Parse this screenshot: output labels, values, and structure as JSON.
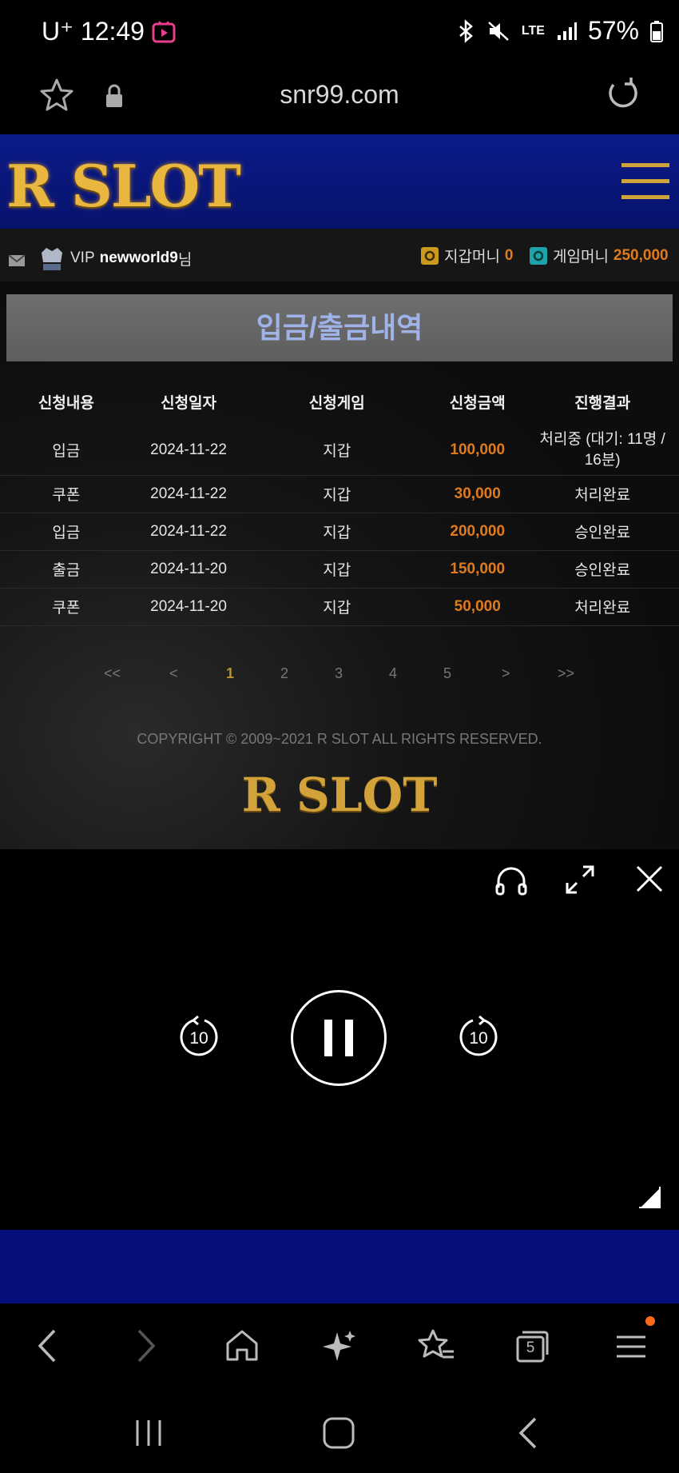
{
  "status_bar": {
    "carrier": "U⁺",
    "time": "12:49",
    "network": "LTE",
    "battery": "57%"
  },
  "browser": {
    "url": "snr99.com",
    "tab_count": "5"
  },
  "site": {
    "logo_text": "R SLOT",
    "user": {
      "level": "VIP",
      "username": "newworld9",
      "suffix": "님",
      "wallet_label": "지갑머니",
      "wallet_value": "0",
      "game_label": "게임머니",
      "game_value": "250,000"
    },
    "page_title": "입금/출금내역",
    "table": {
      "headers": [
        "신청내용",
        "신청일자",
        "신청게임",
        "신청금액",
        "진행결과"
      ],
      "rows": [
        [
          "입금",
          "2024-11-22",
          "지갑",
          "100,000",
          "처리중 (대기: 11명 / 16분)"
        ],
        [
          "쿠폰",
          "2024-11-22",
          "지갑",
          "30,000",
          "처리완료"
        ],
        [
          "입금",
          "2024-11-22",
          "지갑",
          "200,000",
          "승인완료"
        ],
        [
          "출금",
          "2024-11-20",
          "지갑",
          "150,000",
          "승인완료"
        ],
        [
          "쿠폰",
          "2024-11-20",
          "지갑",
          "50,000",
          "처리완료"
        ]
      ]
    },
    "pagination": {
      "first": "<<",
      "prev": "<",
      "pages": [
        "1",
        "2",
        "3",
        "4",
        "5"
      ],
      "next": ">",
      "last": ">>",
      "current": "1"
    },
    "copyright": "COPYRIGHT © 2009~2021 R SLOT ALL RIGHTS RESERVED.",
    "footer_logo": "R SLOT"
  },
  "player": {
    "rewind_label": "10",
    "forward_label": "10"
  },
  "colors": {
    "header_blue": "#0b1a8a",
    "gold": "#e9b640",
    "amount_orange": "#e07b1d"
  }
}
